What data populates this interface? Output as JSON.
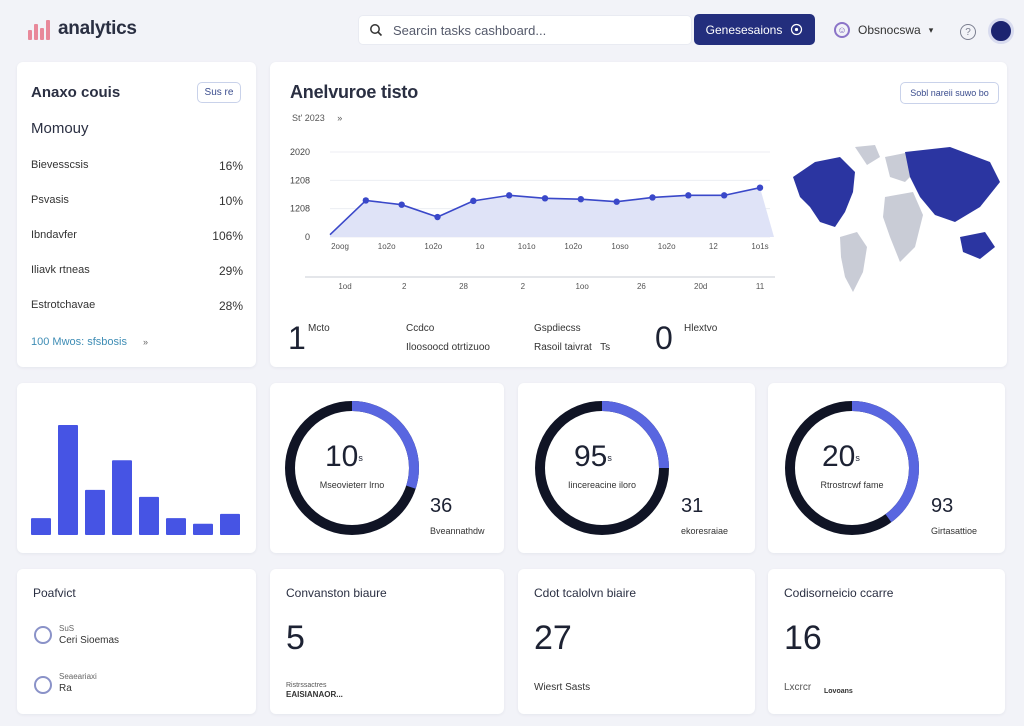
{
  "header": {
    "logo_text": "analytics",
    "search_placeholder": "Searcin tasks cashboard...",
    "action_button": "Genesesaions",
    "user_name": "Obsnocswa",
    "user_caret": "▾",
    "help_icon": "?"
  },
  "overview": {
    "title": "Anaxo couis",
    "badge": "Sus re",
    "subtitle": "Momouy",
    "rows": [
      {
        "label": "Bievesscsis",
        "value": "16%"
      },
      {
        "label": "Psvasis",
        "value": "10%"
      },
      {
        "label": "Ibndavfer",
        "value": "106%"
      },
      {
        "label": "Iliavk rtneas",
        "value": "29%"
      },
      {
        "label": "Estrotchavae",
        "value": "28%"
      }
    ],
    "link": "100 Mwos: sfsbosis",
    "link_caret": "»"
  },
  "main_chart": {
    "title": "Anelvuroe tisto",
    "badge": "Sobl nareii suwo bo",
    "range_label": "St' 2023",
    "range_caret": "»",
    "y_ticks": [
      "2020",
      "1208",
      "1208",
      "0"
    ],
    "x_ticks": [
      "2oog",
      "1o2o",
      "1o2o",
      "1o",
      "1o1o",
      "1o2o",
      "1oso",
      "1o2o",
      "12",
      "1o1s"
    ],
    "x_ticks_lower": [
      "1od",
      "2",
      "28",
      "2",
      "1oo",
      "26",
      "20d",
      "11"
    ],
    "stats": [
      {
        "value": "1",
        "label": "Mcto"
      },
      {
        "label": "Ccdco",
        "sub": "Iloosoocd otrtizuoo"
      },
      {
        "label": "Gspdiecss",
        "sub": "Rasoil taivrat",
        "sub_suffix": "Ts"
      },
      {
        "value": "0",
        "label": "Hlextvo"
      }
    ]
  },
  "chart_data": {
    "type": "area",
    "x": [
      1,
      2,
      3,
      4,
      5,
      6,
      7,
      8,
      9,
      10,
      11,
      12,
      13
    ],
    "values": [
      55,
      860,
      760,
      470,
      850,
      980,
      910,
      890,
      830,
      930,
      980,
      980,
      1160
    ],
    "ylim": [
      0,
      2000
    ],
    "grid": true,
    "color": "#3a48c9",
    "fill": "#dfe3f7"
  },
  "bars": {
    "values": [
      12,
      78,
      32,
      53,
      27,
      12,
      8,
      15
    ],
    "color": "#4654e4"
  },
  "donuts": [
    {
      "value": "10",
      "unit": "s",
      "label": "Mseovieterr lrno",
      "side_value": "36",
      "side_label": "Bveannathdw",
      "fraction": 0.3
    },
    {
      "value": "95",
      "unit": "s",
      "label": "Iincereacine iloro",
      "side_value": "31",
      "side_label": "ekoresraiae",
      "fraction": 0.25
    },
    {
      "value": "20",
      "unit": "s",
      "label": "Rtrostrcwf fame",
      "side_value": "93",
      "side_label": "Girtasattioe",
      "fraction": 0.4
    }
  ],
  "bottom": [
    {
      "title": "Poafvict",
      "items": [
        {
          "small": "SuS",
          "label": "Ceri Sioemas"
        },
        {
          "small": "Seaeariaxi",
          "label": "Ra"
        }
      ]
    },
    {
      "title": "Convanston biaure",
      "value": "5",
      "sub": "Ristrssactres",
      "sub_bold": "EAISIANAOR..."
    },
    {
      "title": "Cdot tcalolvn biaire",
      "value": "27",
      "sub": "Wiesrt Sasts"
    },
    {
      "title": "Codisorneicio ccarre",
      "value": "16",
      "sub": "Lxcrcr",
      "sub_bold": "Lovoans"
    }
  ],
  "colors": {
    "accent": "#232e7d",
    "series": "#3a48c9",
    "donut_dark": "#101425",
    "donut_accent": "#5966e0",
    "link": "#3f8db5"
  }
}
